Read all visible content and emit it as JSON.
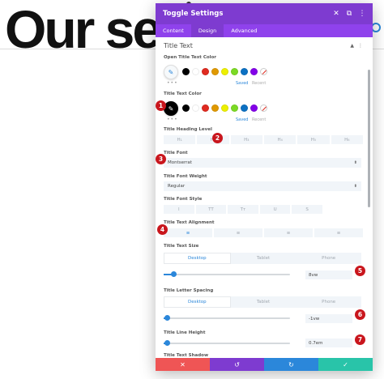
{
  "background": {
    "heading": "Our ser"
  },
  "modal": {
    "title": "Toggle Settings",
    "header_icons": [
      "✕",
      "⧉",
      "⋮"
    ],
    "tabs": [
      {
        "label": "Content",
        "active": false
      },
      {
        "label": "Design",
        "active": true
      },
      {
        "label": "Advanced",
        "active": false
      }
    ]
  },
  "section": {
    "title": "Title Text",
    "icons": [
      "▲",
      "⋮"
    ]
  },
  "open_title_text_color": {
    "label": "Open Title Text Color",
    "saved": "Saved",
    "recent": "Recent",
    "dots": "•••"
  },
  "title_text_color": {
    "label": "Title Text Color",
    "saved": "Saved",
    "recent": "Recent",
    "dots": "•••"
  },
  "swatch_colors": [
    "#000000",
    "#ffffff",
    "#e02b20",
    "#e09900",
    "#edf000",
    "#7cda24",
    "#0c71c3",
    "#8300e9"
  ],
  "title_heading_level": {
    "label": "Title Heading Level",
    "options": [
      "H₁",
      "H₂",
      "H₃",
      "H₄",
      "H₅",
      "H₆"
    ]
  },
  "title_font": {
    "label": "Title Font",
    "value": "Montserrat",
    "caret": "⬍"
  },
  "title_font_weight": {
    "label": "Title Font Weight",
    "value": "Regular",
    "caret": "⬍"
  },
  "title_font_style": {
    "label": "Title Font Style",
    "options": [
      "I",
      "TT",
      "Tт",
      "U",
      "S"
    ]
  },
  "title_text_alignment": {
    "label": "Title Text Alignment",
    "options": [
      "≡",
      "≡",
      "≡",
      "≡"
    ]
  },
  "title_text_size": {
    "label": "Title Text Size",
    "tabs": [
      "Desktop",
      "Tablet",
      "Phone"
    ],
    "value": "8vw",
    "level_fraction": 0.08
  },
  "title_letter_spacing": {
    "label": "Title Letter Spacing",
    "tabs": [
      "Desktop",
      "Tablet",
      "Phone"
    ],
    "value": "-1vw",
    "level_fraction": 0.0
  },
  "title_line_height": {
    "label": "Title Line Height",
    "value": "0.7em",
    "level_fraction": 0.0
  },
  "title_text_shadow": {
    "label": "Title Text Shadow"
  },
  "footer": {
    "buttons": [
      {
        "icon": "✕",
        "color": "#ef5555"
      },
      {
        "icon": "↺",
        "color": "#7e3bd0"
      },
      {
        "icon": "↻",
        "color": "#2b87da"
      },
      {
        "icon": "✓",
        "color": "#29c4a9"
      }
    ]
  },
  "badges": [
    "1",
    "2",
    "3",
    "4",
    "5",
    "6",
    "7"
  ],
  "accent_color": "#2b87da",
  "header_color": "#7e3bd0",
  "badge_color": "#c9161d"
}
